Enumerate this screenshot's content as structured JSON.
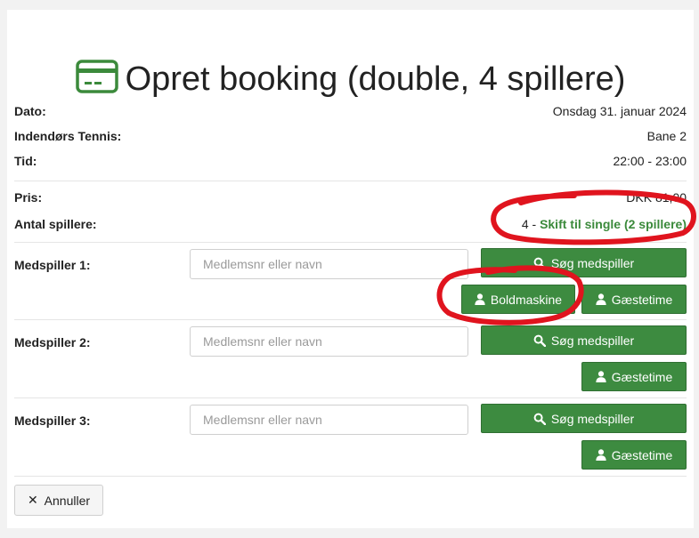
{
  "page": {
    "title": "Opret booking (double, 4 spillere)"
  },
  "info": {
    "date_label": "Dato:",
    "date_value": "Onsdag 31. januar 2024",
    "court_label": "Indendørs Tennis:",
    "court_value": "Bane 2",
    "time_label": "Tid:",
    "time_value": "22:00 - 23:00",
    "price_label": "Pris:",
    "price_value": "DKK 81,00",
    "players_label": "Antal spillere:",
    "players_count": "4",
    "players_sep": " - ",
    "switch_link": "Skift til single (2 spillere)"
  },
  "fellow_players": [
    {
      "label": "Medspiller 1:",
      "placeholder": "Medlemsnr eller navn",
      "search_label": "Søg medspiller",
      "ball_machine_label": "Boldmaskine",
      "guest_label": "Gæstetime"
    },
    {
      "label": "Medspiller 2:",
      "placeholder": "Medlemsnr eller navn",
      "search_label": "Søg medspiller",
      "guest_label": "Gæstetime"
    },
    {
      "label": "Medspiller 3:",
      "placeholder": "Medlemsnr eller navn",
      "search_label": "Søg medspiller",
      "guest_label": "Gæstetime"
    }
  ],
  "actions": {
    "cancel_label": "Annuller"
  },
  "colors": {
    "accent_green": "#3d8b40",
    "annotation_red": "#e0141e",
    "icon_green": "#3b8a3b"
  },
  "icons": {
    "title": "credit-card-icon",
    "search": "search-icon",
    "user": "user-icon",
    "close": "close-icon"
  }
}
